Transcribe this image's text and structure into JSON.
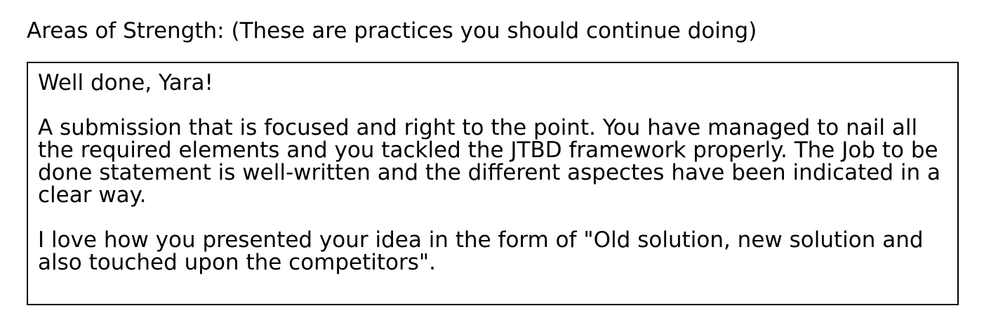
{
  "section": {
    "label": "Areas of Strength: (These are practices you should continue doing)"
  },
  "feedback": {
    "greeting": "Well done, Yara!",
    "paragraph_1": "A submission that is focused and right to the point. You have managed to nail all the required elements and you tackled the JTBD framework properly. The Job to be done statement is well-written and the different aspectes have been indicated in a clear way.",
    "paragraph_2": "I love how you presented your idea in the form of \"Old solution, new solution and also touched upon the competitors\"."
  }
}
